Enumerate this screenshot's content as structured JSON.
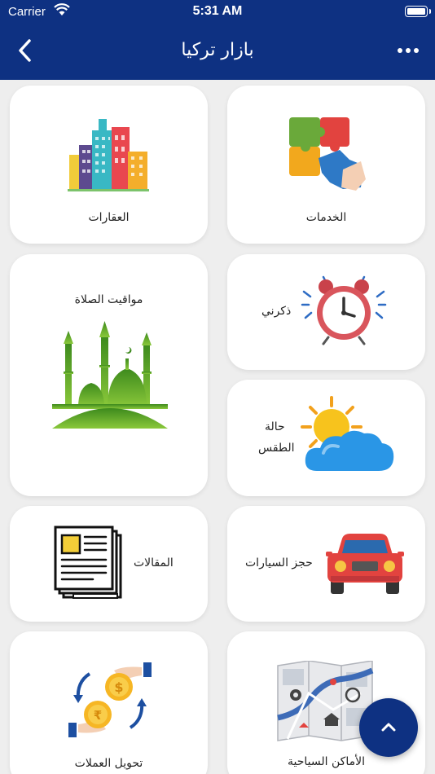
{
  "status_bar": {
    "carrier": "Carrier",
    "time": "5:31 AM"
  },
  "navbar": {
    "title": "بازار تركيا",
    "back_icon": "chevron-left-icon",
    "more_icon": "ellipsis-icon"
  },
  "cards": {
    "services": {
      "label": "الخدمات",
      "icon": "puzzle-icon"
    },
    "real_estate": {
      "label": "العقارات",
      "icon": "buildings-icon"
    },
    "remind_me": {
      "label": "ذكرني",
      "icon": "alarm-clock-icon"
    },
    "prayer_times": {
      "label": "مواقيت الصلاة",
      "icon": "mosque-icon"
    },
    "weather": {
      "label_line1": "حالة",
      "label_line2": "الطقس",
      "icon": "weather-sun-cloud-icon"
    },
    "car_booking": {
      "label": "حجز السيارات",
      "icon": "car-icon"
    },
    "articles": {
      "label": "المقالات",
      "icon": "newspaper-icon"
    },
    "tourist_places": {
      "label": "الأماكن السياحية",
      "icon": "map-icon"
    },
    "currency_exchange": {
      "label": "تحويل العملات",
      "icon": "currency-exchange-icon"
    }
  },
  "fab": {
    "icon": "chevron-up-icon"
  },
  "colors": {
    "primary": "#0e3182",
    "background": "#eeeeee",
    "card": "#ffffff"
  }
}
